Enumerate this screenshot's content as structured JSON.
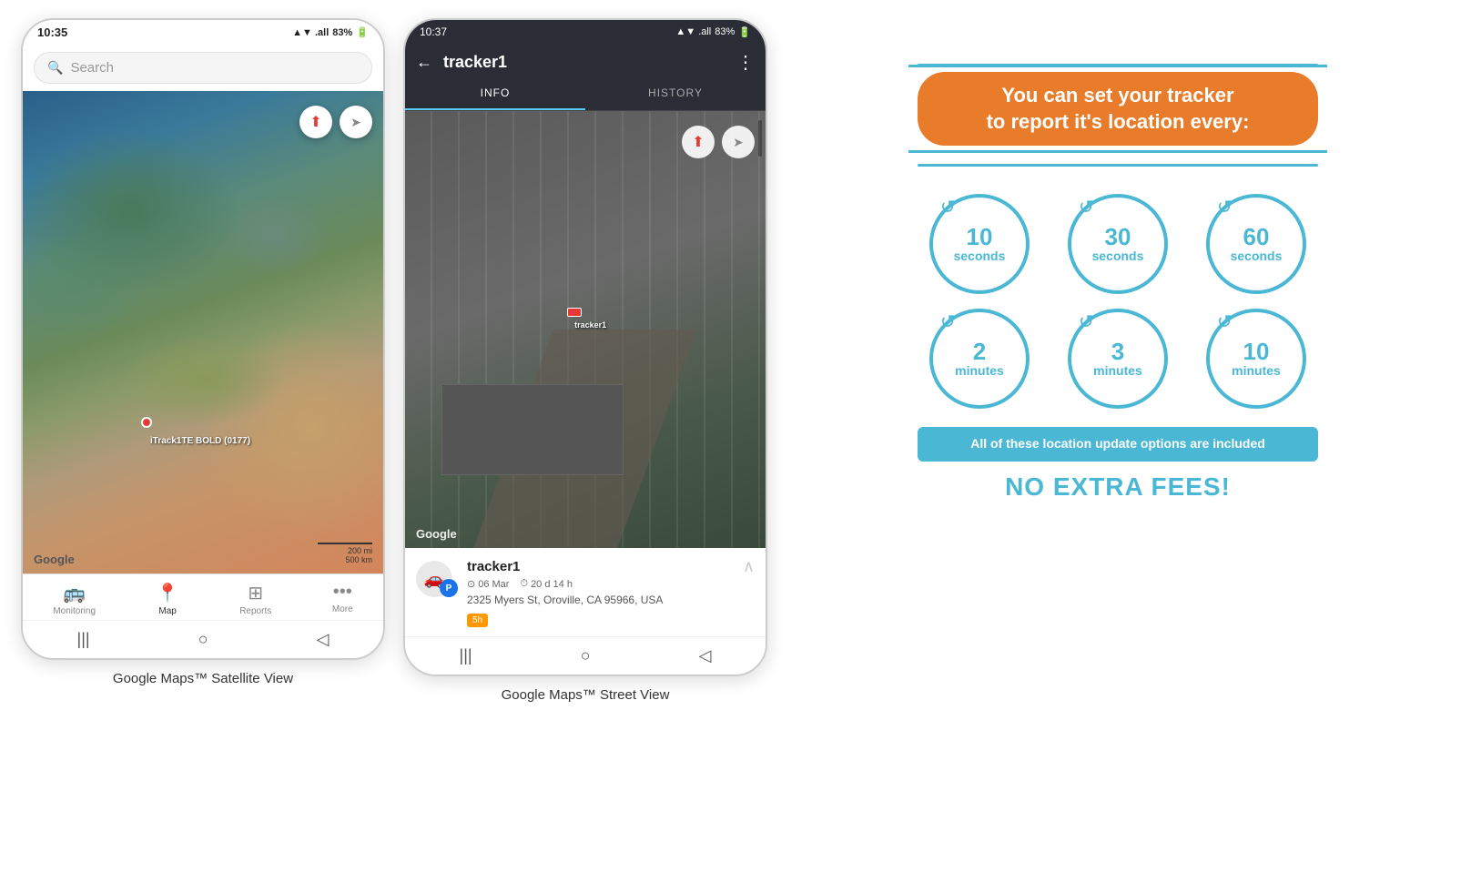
{
  "phone1": {
    "status_bar": {
      "time": "10:35",
      "signal": "▲▼",
      "network": ".all",
      "battery": "83%"
    },
    "search": {
      "placeholder": "Search"
    },
    "map": {
      "tracker_label": "iTrack1TE BOLD (0177)",
      "google_logo": "Google",
      "scale_200mi": "200 mi",
      "scale_500km": "500 km"
    },
    "nav": {
      "items": [
        {
          "label": "Monitoring",
          "icon": "🚌",
          "active": false
        },
        {
          "label": "Map",
          "icon": "📍",
          "active": true
        },
        {
          "label": "Reports",
          "icon": "⊞",
          "active": false
        },
        {
          "label": "More",
          "icon": "•••",
          "active": false
        }
      ]
    },
    "caption": "Google Maps™ Satellite View"
  },
  "phone2": {
    "status_bar": {
      "time": "10:37",
      "battery": "83%"
    },
    "header": {
      "title": "tracker1",
      "back_icon": "←",
      "more_icon": "⋮"
    },
    "tabs": [
      {
        "label": "INFO",
        "active": true
      },
      {
        "label": "HISTORY",
        "active": false
      }
    ],
    "map": {
      "tracker_label": "tracker1",
      "google_logo": "Google"
    },
    "tracker_info": {
      "name": "tracker1",
      "date": "06 Mar",
      "duration": "20 d 14 h",
      "address": "2325 Myers St, Oroville, CA 95966, USA",
      "time_badge": "5h"
    },
    "caption": "Google Maps™ Street View"
  },
  "info_graphic": {
    "headline_line1": "You can set your tracker",
    "headline_line2": "to report it's location every:",
    "circles": [
      {
        "number": "10",
        "unit": "seconds"
      },
      {
        "number": "30",
        "unit": "seconds"
      },
      {
        "number": "60",
        "unit": "seconds"
      },
      {
        "number": "2",
        "unit": "minutes"
      },
      {
        "number": "3",
        "unit": "minutes"
      },
      {
        "number": "10",
        "unit": "minutes"
      }
    ],
    "banner_text": "All of these location update options are included",
    "no_fees_text": "NO EXTRA FEES!"
  }
}
